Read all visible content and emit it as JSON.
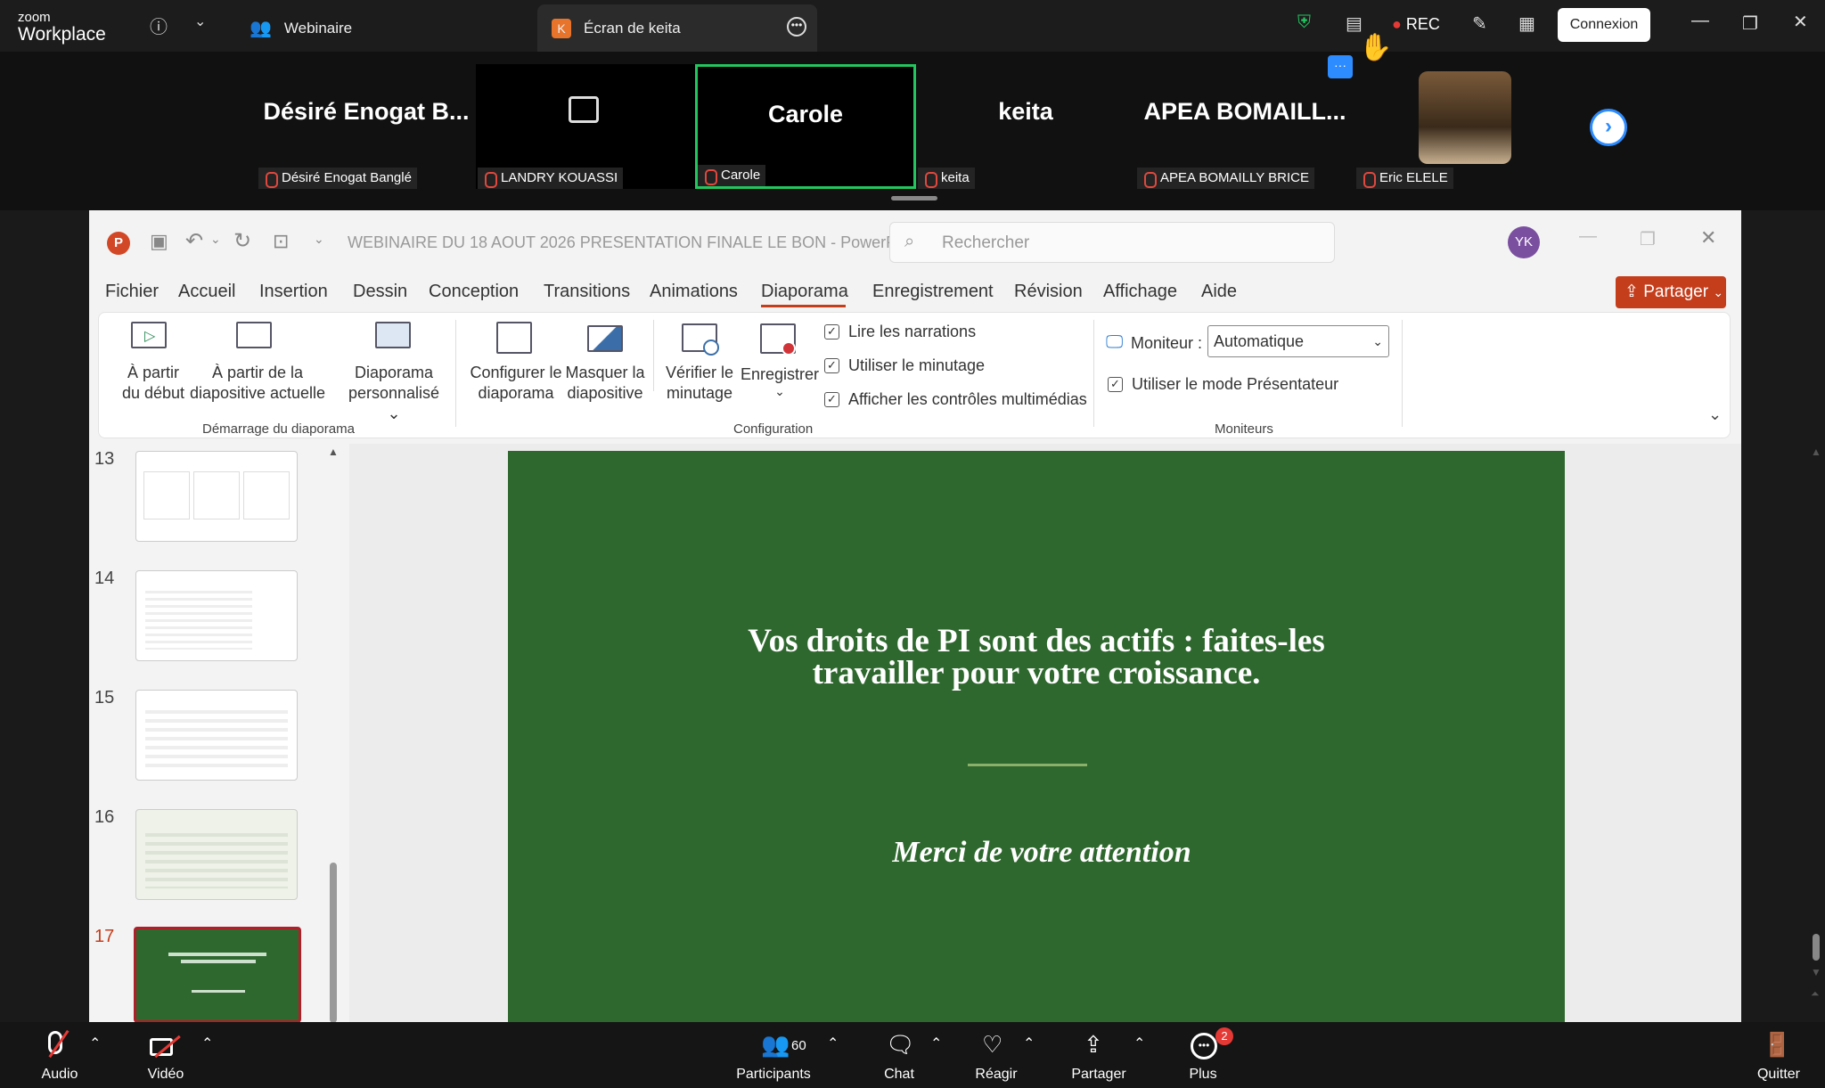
{
  "zoom": {
    "logo_small": "zoom",
    "logo_big": "Workplace",
    "tab_webinar": "Webinaire",
    "tab_screen": "Écran de keita",
    "tab_screen_badge": "K",
    "rec_label": "REC",
    "connexion_label": "Connexion"
  },
  "participants": [
    {
      "display": "Désiré Enogat B...",
      "label": "Désiré Enogat Banglé"
    },
    {
      "display": "",
      "label": "LANDRY KOUASSI"
    },
    {
      "display": "Carole",
      "label": "Carole"
    },
    {
      "display": "keita",
      "label": "keita"
    },
    {
      "display": "APEA   BOMAILL...",
      "label": "APEA  BOMAILLY BRICE"
    },
    {
      "display": "",
      "label": "Eric ELELE"
    }
  ],
  "ppt": {
    "app_badge": "P",
    "doc_title": "WEBINAIRE DU 18 AOUT 2026 PRESENTATION FINALE LE BON  -  PowerP...",
    "search_placeholder": "Rechercher",
    "avatar_initials": "YK",
    "menu": [
      "Fichier",
      "Accueil",
      "Insertion",
      "Dessin",
      "Conception",
      "Transitions",
      "Animations",
      "Diaporama",
      "Enregistrement",
      "Révision",
      "Affichage",
      "Aide"
    ],
    "share_label": "Partager",
    "ribbon": {
      "from_start": [
        "À partir",
        "du début"
      ],
      "from_current": [
        "À partir de la",
        "diapositive actuelle"
      ],
      "custom_show": [
        "Diaporama",
        "personnalisé ⌄"
      ],
      "group_start": "Démarrage du diaporama",
      "setup": [
        "Configurer le",
        "diaporama"
      ],
      "hide": [
        "Masquer la",
        "diapositive"
      ],
      "rehearse": [
        "Vérifier le",
        "minutage"
      ],
      "record": [
        "Enregistrer",
        "⌄"
      ],
      "chk_narrations": "Lire les narrations",
      "chk_timings": "Utiliser le minutage",
      "chk_media": "Afficher les contrôles multimédias",
      "group_config": "Configuration",
      "monitor_label": "Moniteur :",
      "monitor_value": "Automatique",
      "chk_presenter": "Utiliser le mode Présentateur",
      "group_monitors": "Moniteurs"
    },
    "thumb_numbers": [
      "13",
      "14",
      "15",
      "16",
      "17"
    ],
    "slide": {
      "title_line1": "Vos droits de PI sont des actifs : faites-les",
      "title_line2": "travailler pour votre croissance.",
      "subtitle": "Merci de votre attention"
    }
  },
  "bottom": {
    "audio": "Audio",
    "video": "Vidéo",
    "participants": "Participants",
    "participants_count": "60",
    "chat": "Chat",
    "react": "Réagir",
    "share": "Partager",
    "more": "Plus",
    "more_badge": "2",
    "quit": "Quitter"
  },
  "colors": {
    "slide_green": "#2e682e",
    "active_speaker": "#22c55e",
    "share_btn": "#c43e1c",
    "accent_blue": "#2d8cff",
    "menu_underline": "#c43e1c"
  }
}
